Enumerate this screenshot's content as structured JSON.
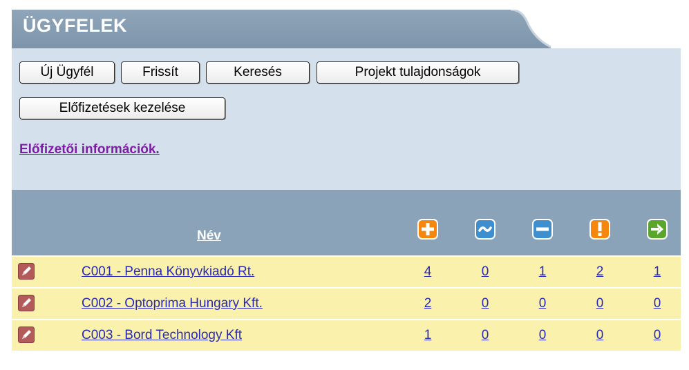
{
  "header": {
    "title": "ÜGYFELEK"
  },
  "toolbar": {
    "new_customer": "Új Ügyfél",
    "refresh": "Frissít",
    "search": "Keresés",
    "project_properties": "Projekt tulajdonságok",
    "manage_subscriptions": "Előfizetések kezelése"
  },
  "subscriber_info_link": "Előfizetői információk.",
  "table": {
    "name_header": "Név",
    "status_icons": [
      {
        "name": "plus-icon",
        "color": "#f5870f"
      },
      {
        "name": "tilde-icon",
        "color": "#3f8fcf"
      },
      {
        "name": "minus-icon",
        "color": "#3f8fcf"
      },
      {
        "name": "exclamation-icon",
        "color": "#f5870f"
      },
      {
        "name": "arrow-right-icon",
        "color": "#5aa62c"
      }
    ],
    "rows": [
      {
        "name": "C001 - Penna Könyvkiadó Rt.",
        "counts": [
          "4",
          "0",
          "1",
          "2",
          "1"
        ]
      },
      {
        "name": "C002 - Optoprima Hungary Kft.",
        "counts": [
          "2",
          "0",
          "0",
          "0",
          "0"
        ]
      },
      {
        "name": "C003 - Bord Technology Kft",
        "counts": [
          "1",
          "0",
          "0",
          "0",
          "0"
        ]
      }
    ]
  }
}
